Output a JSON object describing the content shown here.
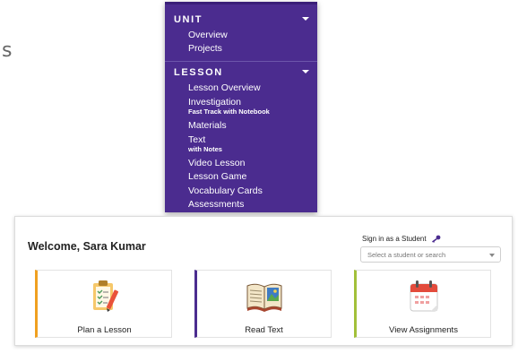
{
  "background_letter": "s",
  "menu": {
    "unit_heading": "UNIT",
    "unit_items": [
      "Overview",
      "Projects"
    ],
    "lesson_heading": "LESSON",
    "lesson_items": [
      {
        "label": "Lesson Overview"
      },
      {
        "label": "Investigation",
        "sub": "Fast Track with Notebook"
      },
      {
        "label": "Materials"
      },
      {
        "label": "Text",
        "sub": "with Notes"
      },
      {
        "label": "Video Lesson"
      },
      {
        "label": "Lesson Game"
      },
      {
        "label": "Vocabulary Cards"
      },
      {
        "label": "Assessments"
      }
    ],
    "colors": {
      "background": "#4b2c8f",
      "text": "#ffffff"
    }
  },
  "dashboard": {
    "welcome": "Welcome, Sara Kumar",
    "signin_label": "Sign in as a Student",
    "student_select_placeholder": "Select a student or search",
    "cards": [
      {
        "label": "Plan a Lesson",
        "icon": "clipboard-checklist-icon",
        "accent": "#f0a020"
      },
      {
        "label": "Read Text",
        "icon": "open-book-icon",
        "accent": "#4b2c8f"
      },
      {
        "label": "View Assignments",
        "icon": "calendar-icon",
        "accent": "#a2c03a"
      }
    ]
  }
}
